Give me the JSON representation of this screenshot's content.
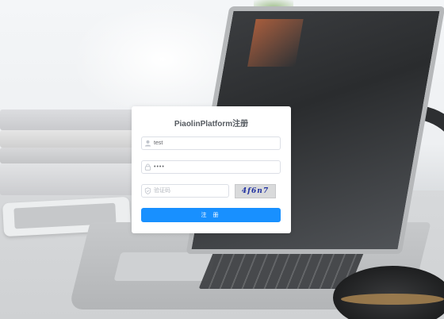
{
  "form": {
    "title": "PiaolinPlatform注册",
    "username": {
      "value": "test",
      "icon": "user-icon"
    },
    "password": {
      "value": "••••",
      "icon": "lock-icon"
    },
    "verify_code": {
      "value": "",
      "placeholder": "验证码",
      "icon": "shield-icon"
    },
    "captcha_text": "4f6n7",
    "submit_label": "注 册"
  },
  "colors": {
    "primary": "#1890ff",
    "border": "#dcdfe6",
    "title_text": "#555a60"
  }
}
